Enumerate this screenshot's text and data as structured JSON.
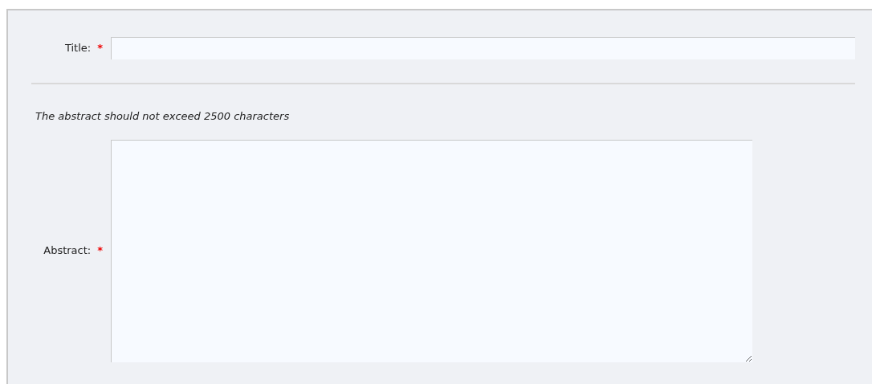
{
  "title_field": {
    "label": "Title:",
    "required": true,
    "required_mark": "*"
  },
  "abstract_note": "The abstract should not exceed 2500 characters",
  "abstract_field": {
    "label": "Abstract:",
    "required": true,
    "required_mark": "*"
  }
}
